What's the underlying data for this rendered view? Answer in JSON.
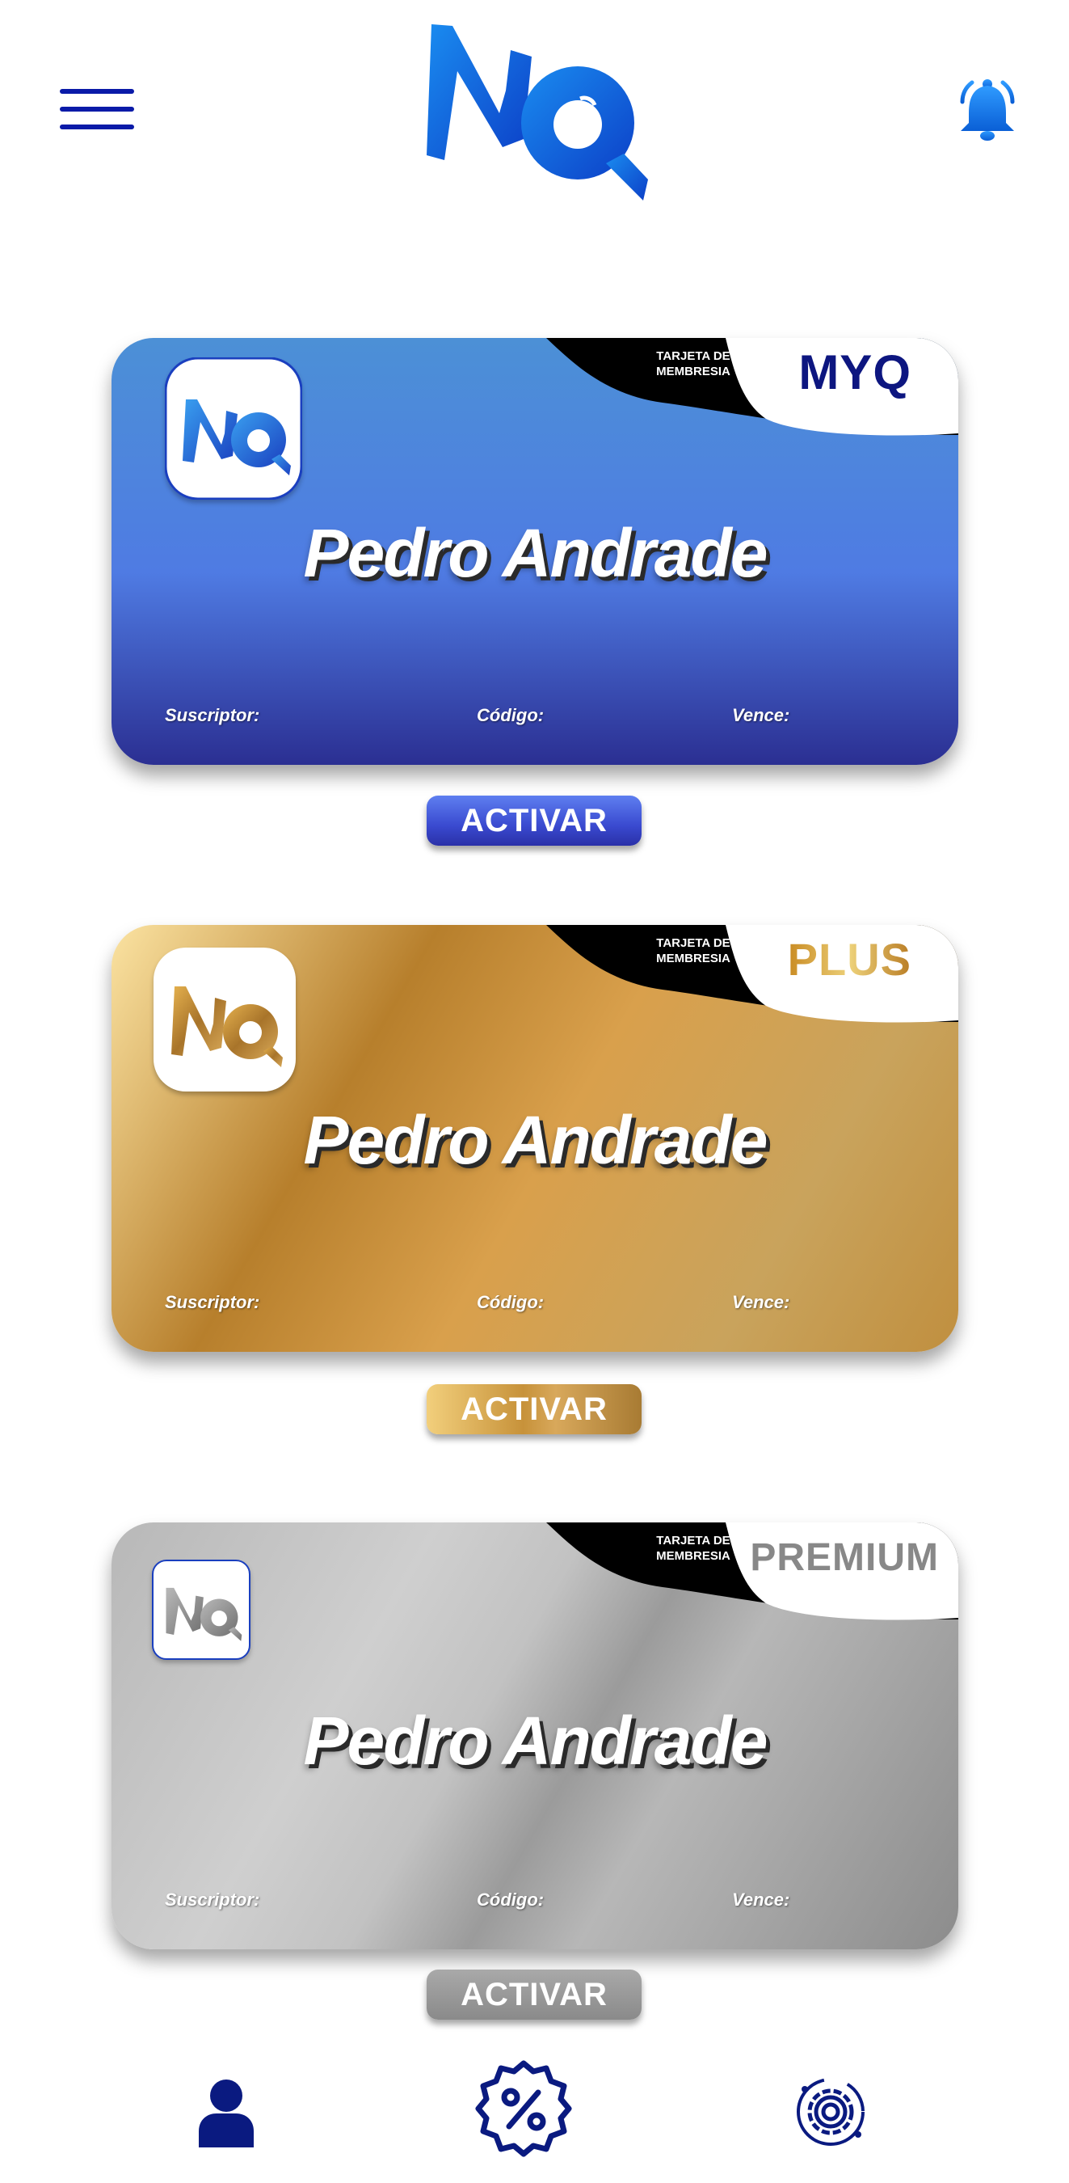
{
  "app": {
    "logo_text": "MQ",
    "accent_color": "#0a1aa8",
    "brand_blue": "#1f6fe0"
  },
  "header": {
    "menu_icon": "hamburger-menu-icon",
    "notification_icon": "bell-icon"
  },
  "cards": [
    {
      "tier": "MYQ",
      "membership_label_line1": "TARJETA DE",
      "membership_label_line2": "MEMBRESIA",
      "holder_name": "Pedro Andrade",
      "subscriber_label": "Suscriptor:",
      "code_label": "Código:",
      "expires_label": "Vence:",
      "theme_color": "#4f7be3",
      "activate_label": "ACTIVAR"
    },
    {
      "tier": "PLUS",
      "membership_label_line1": "TARJETA DE",
      "membership_label_line2": "MEMBRESIA",
      "holder_name": "Pedro Andrade",
      "subscriber_label": "Suscriptor:",
      "code_label": "Código:",
      "expires_label": "Vence:",
      "theme_color": "#d9a04c",
      "activate_label": "ACTIVAR"
    },
    {
      "tier": "PREMIUM",
      "membership_label_line1": "TARJETA DE",
      "membership_label_line2": "MEMBRESIA",
      "holder_name": "Pedro Andrade",
      "subscriber_label": "Suscriptor:",
      "code_label": "Código:",
      "expires_label": "Vence:",
      "theme_color": "#a8a8a8",
      "activate_label": "ACTIVAR"
    }
  ],
  "bottom_nav": {
    "items": [
      {
        "icon": "user-profile-icon"
      },
      {
        "icon": "discount-badge-icon"
      },
      {
        "icon": "settings-gear-icon"
      }
    ]
  }
}
